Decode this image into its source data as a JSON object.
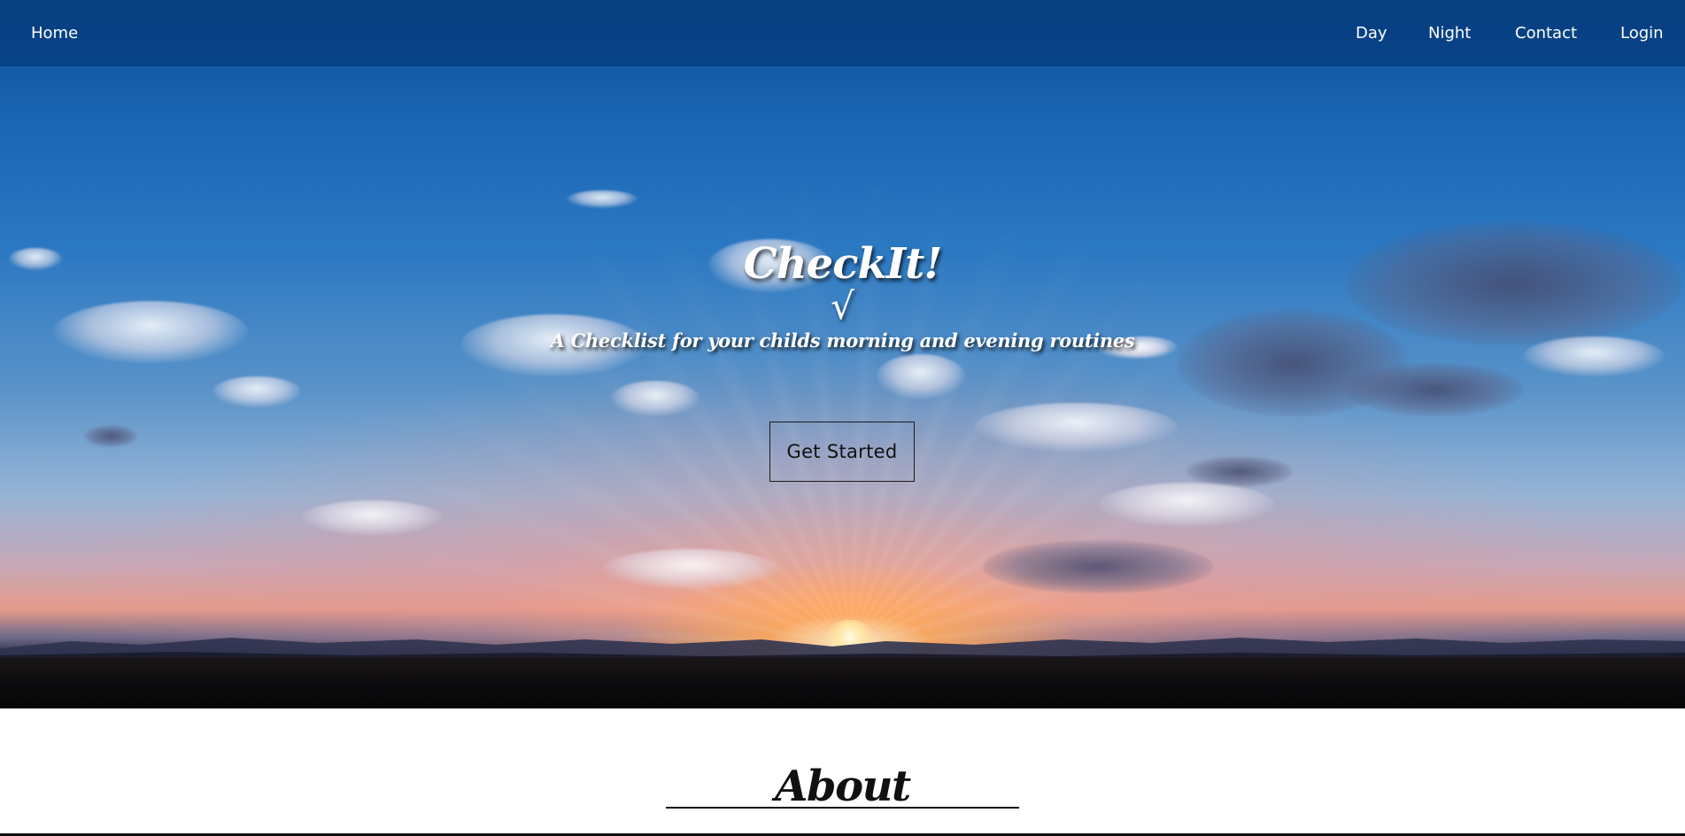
{
  "nav": {
    "home": "Home",
    "day": "Day",
    "night": "Night",
    "contact": "Contact",
    "login": "Login"
  },
  "hero": {
    "title": "CheckIt!",
    "check_glyph": "√",
    "subtitle": "A Checklist for your childs morning and evening routines",
    "cta_label": "Get Started"
  },
  "about": {
    "title": "About"
  },
  "colors": {
    "navbar": "#043a7a",
    "hero_text": "#ffffff",
    "cta_text": "#111111"
  },
  "icons": {
    "check": "checkmark-icon"
  }
}
